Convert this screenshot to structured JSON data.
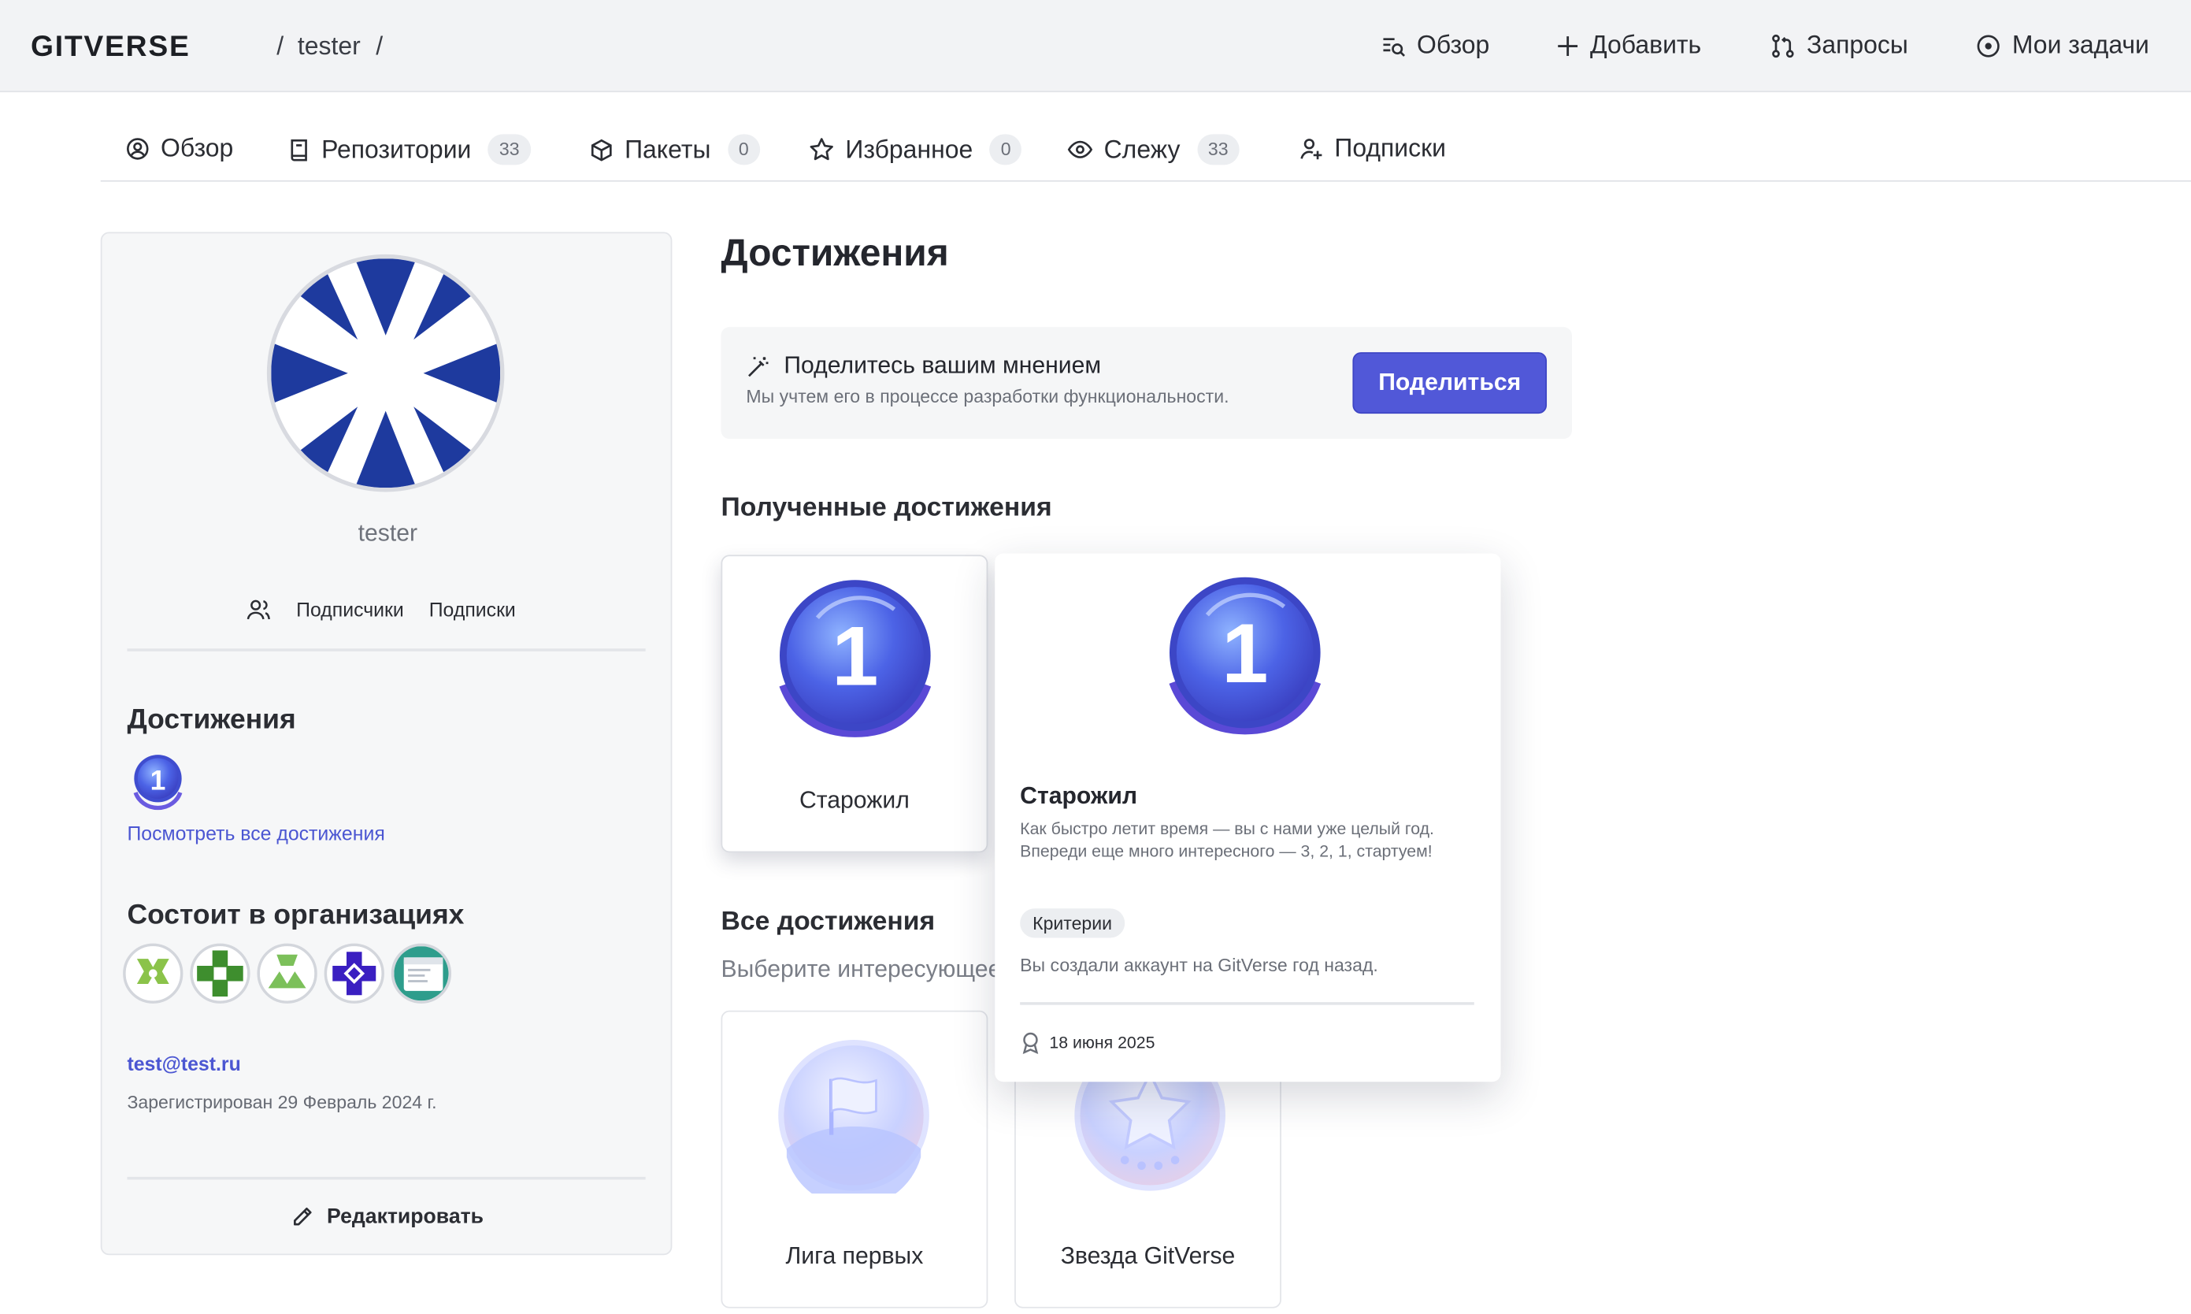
{
  "topbar": {
    "logo": "GITVERSE",
    "breadcrumb": {
      "sep1": "/",
      "user": "tester",
      "sep2": "/"
    },
    "nav": [
      {
        "icon": "overview-search-icon",
        "label": "Обзор"
      },
      {
        "icon": "plus-icon",
        "label": "Добавить"
      },
      {
        "icon": "pull-request-icon",
        "label": "Запросы"
      },
      {
        "icon": "circle-dot-icon",
        "label": "Мои задачи"
      }
    ]
  },
  "tabs": [
    {
      "icon": "user-circle-icon",
      "label": "Обзор"
    },
    {
      "icon": "book-icon",
      "label": "Репозитории",
      "count": "33"
    },
    {
      "icon": "package-icon",
      "label": "Пакеты",
      "count": "0"
    },
    {
      "icon": "star-icon",
      "label": "Избранное",
      "count": "0"
    },
    {
      "icon": "eye-icon",
      "label": "Слежу",
      "count": "33"
    },
    {
      "icon": "user-plus-icon",
      "label": "Подписки"
    }
  ],
  "sidebar": {
    "username": "tester",
    "followers_label": "Подписчики",
    "following_label": "Подписки",
    "achievements_title": "Достижения",
    "view_all_link": "Посмотреть все достижения",
    "orgs_title": "Состоит в организациях",
    "email": "test@test.ru",
    "registered": "Зарегистрирован 29 Февраль 2024 г.",
    "edit_label": "Редактировать"
  },
  "main": {
    "title": "Достижения",
    "feedback": {
      "title": "Поделитесь вашим мнением",
      "subtitle": "Мы учтем его в процессе разработки функциональности.",
      "button": "Поделиться"
    },
    "received_title": "Полученные достижения",
    "received": [
      {
        "name": "Старожил",
        "number": "1"
      }
    ],
    "all_title": "Все достижения",
    "all_subtitle": "Выберите интересующее",
    "all": [
      {
        "name": "Лига первых",
        "icon": "flag-medal-icon"
      },
      {
        "name": "Звезда GitVerse",
        "icon": "star-medal-icon"
      }
    ]
  },
  "popup": {
    "number": "1",
    "title": "Старожил",
    "description": "Как быстро летит время — вы с нами уже целый год. Впереди еще много интересного — 3, 2, 1, стартуем!",
    "chip": "Критерии",
    "criteria": "Вы создали аккаунт на GitVerse год назад.",
    "date": "18 июня 2025"
  },
  "colors": {
    "accent": "#5158d8",
    "link": "#4b56d2",
    "medal": "#4b5de0"
  }
}
